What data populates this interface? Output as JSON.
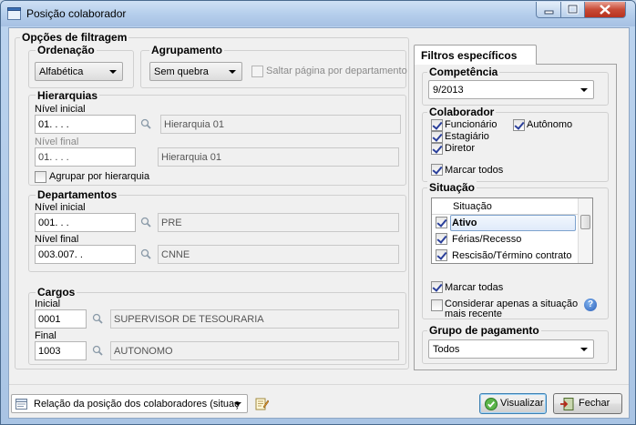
{
  "window": {
    "title": "Posição colaborador"
  },
  "filter_options": {
    "title": "Opções de filtragem",
    "ordenacao": {
      "title": "Ordenação",
      "value": "Alfabética"
    },
    "agrupamento": {
      "title": "Agrupamento",
      "value": "Sem quebra",
      "skip_page_label": "Saltar página por departamento"
    },
    "hierarquias": {
      "title": "Hierarquias",
      "initial_label": "Nível inicial",
      "initial_code": "01.   .   .   .",
      "initial_desc": "Hierarquia 01",
      "final_label": "Nível final",
      "final_code": "01.   .   .   .",
      "final_desc": "Hierarquia 01",
      "group_label": "Agrupar por hierarquia"
    },
    "departamentos": {
      "title": "Departamentos",
      "initial_label": "Nível inicial",
      "initial_code": "001.   .   .",
      "initial_desc": "PRE",
      "final_label": "Nível final",
      "final_code": "003.007.   .",
      "final_desc": "CNNE"
    },
    "cargos": {
      "title": "Cargos",
      "initial_label": "Inicial",
      "initial_code": "0001",
      "initial_desc": "SUPERVISOR DE TESOURARIA",
      "final_label": "Final",
      "final_code": "1003",
      "final_desc": "AUTONOMO"
    }
  },
  "specific_filters": {
    "tab_label": "Filtros específicos",
    "competencia": {
      "title": "Competência",
      "value": "9/2013"
    },
    "colaborador": {
      "title": "Colaborador",
      "items": [
        {
          "label": "Funcionário",
          "checked": true
        },
        {
          "label": "Autônomo",
          "checked": true
        },
        {
          "label": "Estagiário",
          "checked": true
        },
        {
          "label": "Diretor",
          "checked": true
        }
      ],
      "mark_all_label": "Marcar todos"
    },
    "situacao": {
      "title": "Situação",
      "column_header": "Situação",
      "rows": [
        {
          "label": "Ativo",
          "checked": true
        },
        {
          "label": "Férias/Recesso",
          "checked": true
        },
        {
          "label": "Rescisão/Término contrato",
          "checked": true
        }
      ],
      "mark_all_label": "Marcar todas",
      "recent_label_line1": "Considerar apenas a situação",
      "recent_label_line2": "mais recente",
      "help_glyph": "?"
    },
    "grupo_pagamento": {
      "title": "Grupo de pagamento",
      "value": "Todos"
    }
  },
  "footer": {
    "report_value": "Relação da posição dos colaboradores (situaç",
    "visualizar_label": "Visualizar",
    "fechar_label": "Fechar"
  },
  "colors": {
    "accent": "#3399ff",
    "window_frame": "#a9c4e4",
    "close_red": "#c74a35"
  }
}
